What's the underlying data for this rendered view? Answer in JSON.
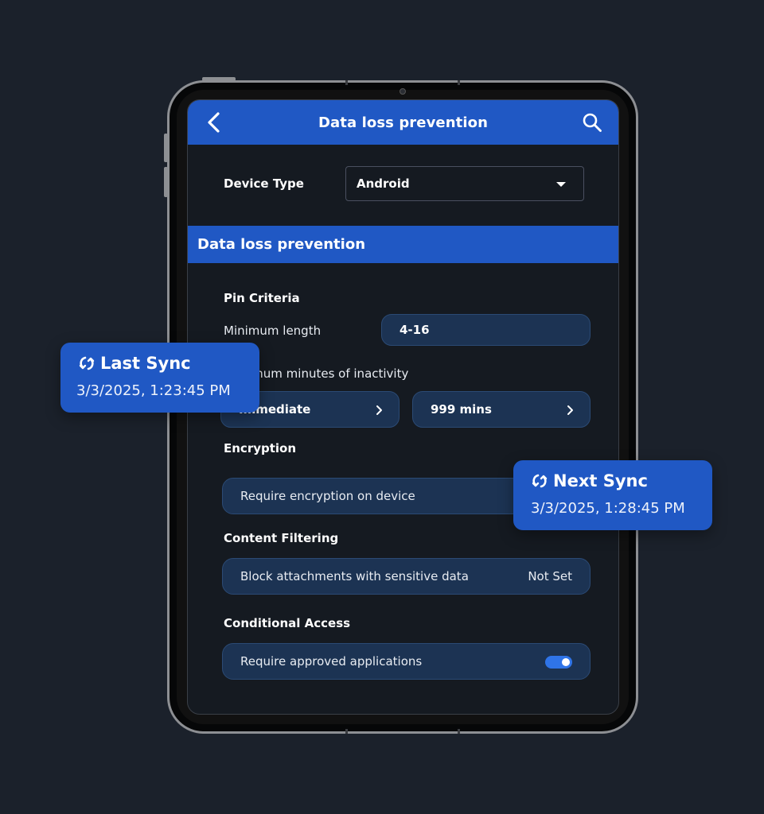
{
  "appbar": {
    "title": "Data loss prevention",
    "back_icon": "chevron-left-icon",
    "search_icon": "search-icon"
  },
  "device": {
    "label": "Device Type",
    "selected": "Android"
  },
  "section": {
    "title": "Data loss prevention"
  },
  "pin": {
    "heading": "Pin Criteria",
    "min_length_label": "Minimum length",
    "min_length_value": "4-16",
    "inactivity_label": "Maximum minutes of inactivity",
    "inactivity_min": "Immediate",
    "inactivity_max": "999 mins"
  },
  "encryption": {
    "heading": "Encryption",
    "option": "Require encryption on device"
  },
  "content_filtering": {
    "heading": "Content Filtering",
    "option": "Block attachments with sensitive data",
    "value": "Not Set"
  },
  "conditional_access": {
    "heading": "Conditional Access",
    "option": "Require approved applications",
    "enabled": true
  },
  "last_sync": {
    "title": "Last Sync",
    "time": "3/3/2025, 1:23:45 PM"
  },
  "next_sync": {
    "title": "Next Sync",
    "time": "3/3/2025, 1:28:45 PM"
  },
  "colors": {
    "background": "#1b212b",
    "accent": "#2058c4",
    "pill": "#1c3353",
    "toggle_on": "#2f74e8"
  }
}
